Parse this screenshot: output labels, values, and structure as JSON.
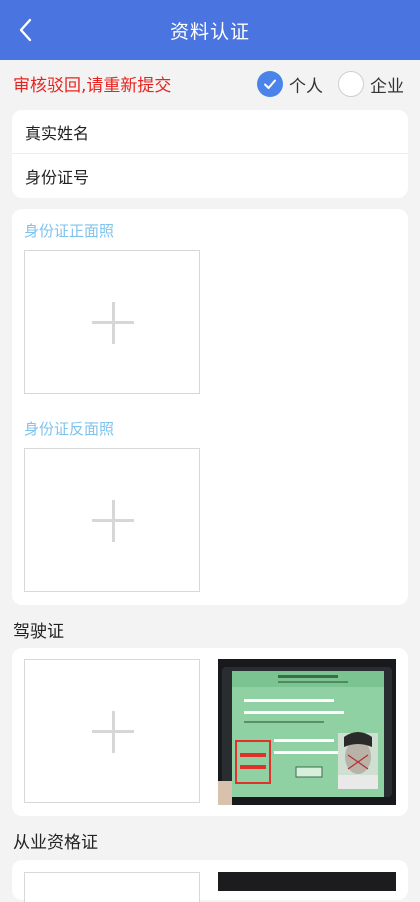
{
  "header": {
    "title": "资料认证"
  },
  "status": {
    "reject_message": "审核驳回,请重新提交"
  },
  "type_selector": {
    "options": [
      {
        "label": "个人",
        "selected": true
      },
      {
        "label": "企业",
        "selected": false
      }
    ]
  },
  "form": {
    "fields": [
      {
        "label": "真实姓名"
      },
      {
        "label": "身份证号"
      }
    ]
  },
  "id_card": {
    "front_label": "身份证正面照",
    "back_label": "身份证反面照"
  },
  "driver_license": {
    "title": "驾驶证"
  },
  "qualification": {
    "title": "从业资格证"
  },
  "colors": {
    "header_bg": "#4a74df",
    "reject_text": "#e8231f",
    "photo_label": "#7ec2ee",
    "radio_selected": "#4a84ea"
  }
}
